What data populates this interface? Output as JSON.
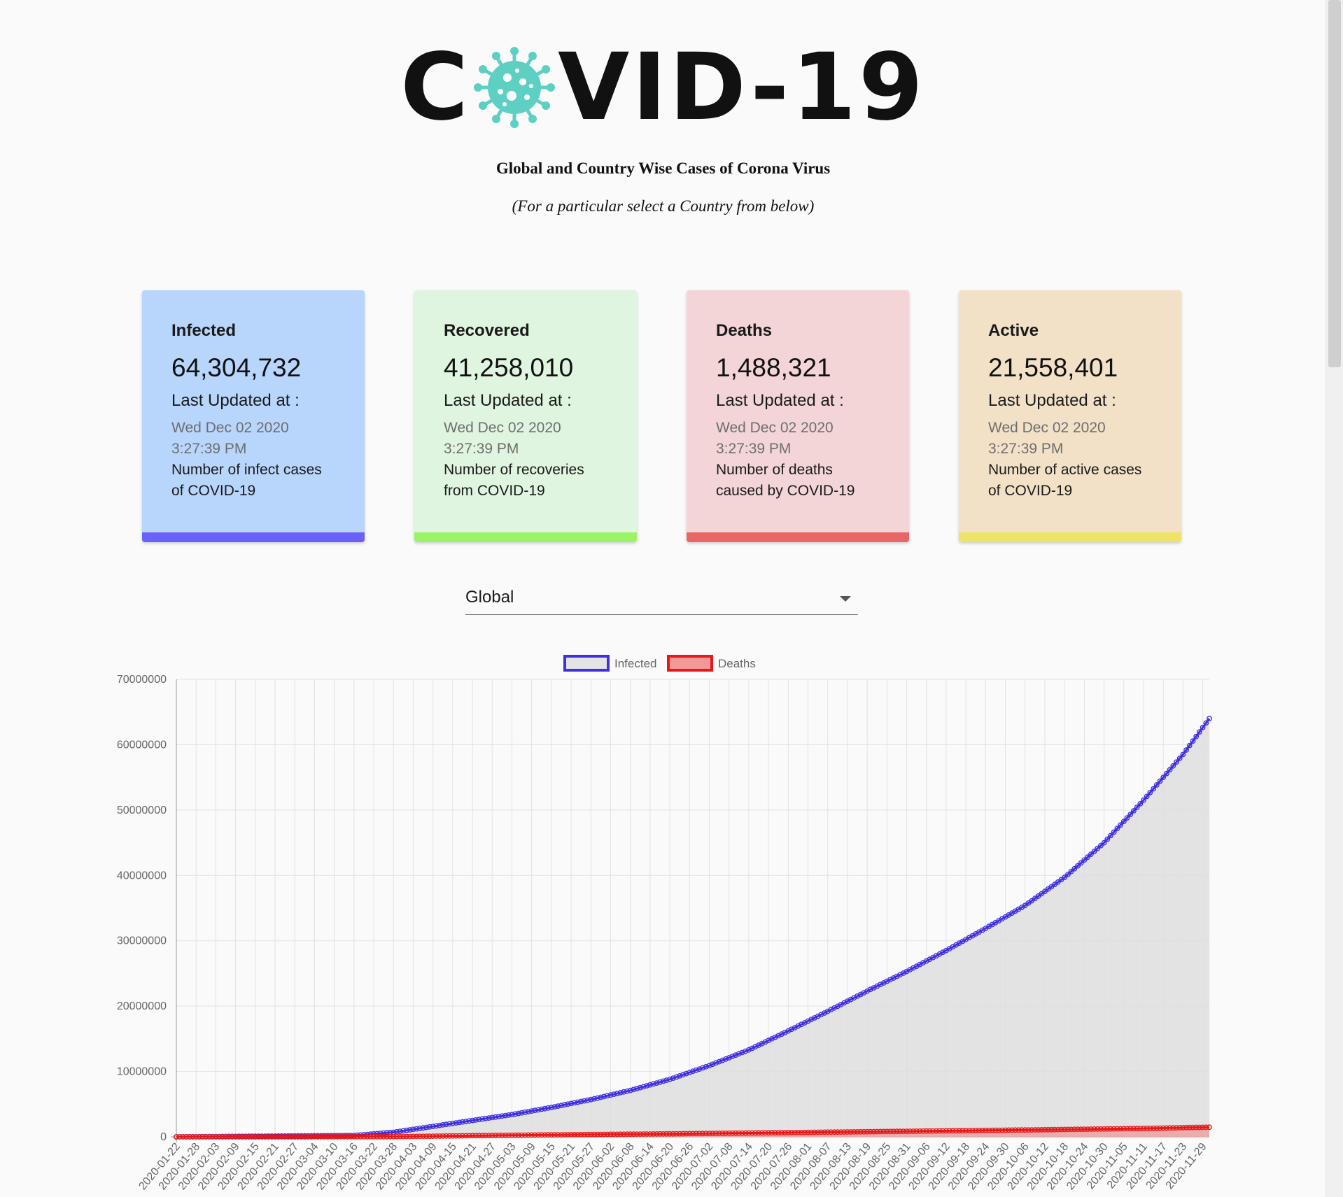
{
  "header": {
    "logo_left": "C",
    "logo_right": "VID-19",
    "subtitle": "Global and Country Wise Cases of Corona Virus",
    "hint": "(For a particular select a Country from below)"
  },
  "cards": [
    {
      "title": "Infected",
      "value": "64,304,732",
      "updated_label": "Last Updated at :",
      "date": "Wed Dec 02 2020",
      "time": "3:27:39 PM",
      "desc1": "Number of infect cases",
      "desc2": "of COVID-19",
      "bg": "#b8d5fc",
      "bar": "#6a62f8"
    },
    {
      "title": "Recovered",
      "value": "41,258,010",
      "updated_label": "Last Updated at :",
      "date": "Wed Dec 02 2020",
      "time": "3:27:39 PM",
      "desc1": "Number of recoveries",
      "desc2": "from COVID-19",
      "bg": "#e0f5df",
      "bar": "#9af466"
    },
    {
      "title": "Deaths",
      "value": "1,488,321",
      "updated_label": "Last Updated at :",
      "date": "Wed Dec 02 2020",
      "time": "3:27:39 PM",
      "desc1": "Number of deaths",
      "desc2": "caused by COVID-19",
      "bg": "#f3d5d7",
      "bar": "#ea6565"
    },
    {
      "title": "Active",
      "value": "21,558,401",
      "updated_label": "Last Updated at :",
      "date": "Wed Dec 02 2020",
      "time": "3:27:39 PM",
      "desc1": "Number of active cases",
      "desc2": "of COVID-19",
      "bg": "#f2e1c7",
      "bar": "#eee366"
    }
  ],
  "country_select": {
    "value": "Global"
  },
  "icons": {
    "logo_o": "virus-icon",
    "select": "dropdown-arrow-icon"
  },
  "colors": {
    "logo_virus": "#5ecfc3"
  },
  "chart_data": {
    "type": "line",
    "legend": {
      "position": "top",
      "entries": [
        "Infected",
        "Deaths"
      ]
    },
    "ylim": [
      0,
      70000000
    ],
    "yticks": [
      0,
      10000000,
      20000000,
      30000000,
      40000000,
      50000000,
      60000000,
      70000000
    ],
    "grid": true,
    "x_start": "2020-01-22",
    "x_end": "2020-12-01",
    "x_tick_labels": [
      "2020-01-22",
      "2020-01-28",
      "2020-02-03",
      "2020-02-09",
      "2020-02-15",
      "2020-02-21",
      "2020-02-27",
      "2020-03-04",
      "2020-03-10",
      "2020-03-16",
      "2020-03-22",
      "2020-03-28",
      "2020-04-03",
      "2020-04-09",
      "2020-04-15",
      "2020-04-21",
      "2020-04-27",
      "2020-05-03",
      "2020-05-09",
      "2020-05-15",
      "2020-05-21",
      "2020-05-27",
      "2020-06-02",
      "2020-06-08",
      "2020-06-14",
      "2020-06-20",
      "2020-06-26",
      "2020-07-02",
      "2020-07-08",
      "2020-07-14",
      "2020-07-20",
      "2020-07-26",
      "2020-08-01",
      "2020-08-07",
      "2020-08-13",
      "2020-08-19",
      "2020-08-25",
      "2020-08-31",
      "2020-09-06",
      "2020-09-12",
      "2020-09-18",
      "2020-09-24",
      "2020-09-30",
      "2020-10-06",
      "2020-10-12",
      "2020-10-18",
      "2020-10-24",
      "2020-10-30",
      "2020-11-05",
      "2020-11-11",
      "2020-11-17",
      "2020-11-23",
      "2020-11-29"
    ],
    "series": [
      {
        "name": "Infected",
        "line_color": "#3f2fe0",
        "fill_color": "#dedede",
        "points": [
          [
            "2020-01-22",
            0
          ],
          [
            "2020-03-16",
            200000
          ],
          [
            "2020-03-28",
            700000
          ],
          [
            "2020-04-09",
            1600000
          ],
          [
            "2020-04-21",
            2500000
          ],
          [
            "2020-05-03",
            3400000
          ],
          [
            "2020-05-15",
            4500000
          ],
          [
            "2020-05-27",
            5700000
          ],
          [
            "2020-06-08",
            7100000
          ],
          [
            "2020-06-20",
            8800000
          ],
          [
            "2020-07-02",
            10900000
          ],
          [
            "2020-07-14",
            13300000
          ],
          [
            "2020-07-26",
            16200000
          ],
          [
            "2020-08-07",
            19200000
          ],
          [
            "2020-08-19",
            22300000
          ],
          [
            "2020-08-31",
            25300000
          ],
          [
            "2020-09-12",
            28500000
          ],
          [
            "2020-09-24",
            31900000
          ],
          [
            "2020-10-06",
            35400000
          ],
          [
            "2020-10-18",
            39700000
          ],
          [
            "2020-10-30",
            45000000
          ],
          [
            "2020-11-11",
            51500000
          ],
          [
            "2020-11-23",
            58500000
          ],
          [
            "2020-12-01",
            64000000
          ]
        ]
      },
      {
        "name": "Deaths",
        "line_color": "#e81818",
        "fill_color": "#f08080",
        "points": [
          [
            "2020-01-22",
            0
          ],
          [
            "2020-03-16",
            7000
          ],
          [
            "2020-03-28",
            30000
          ],
          [
            "2020-04-09",
            95000
          ],
          [
            "2020-04-21",
            180000
          ],
          [
            "2020-05-15",
            300000
          ],
          [
            "2020-06-20",
            460000
          ],
          [
            "2020-07-26",
            645000
          ],
          [
            "2020-08-31",
            850000
          ],
          [
            "2020-10-06",
            1050000
          ],
          [
            "2020-11-11",
            1280000
          ],
          [
            "2020-12-01",
            1480000
          ]
        ]
      }
    ]
  }
}
